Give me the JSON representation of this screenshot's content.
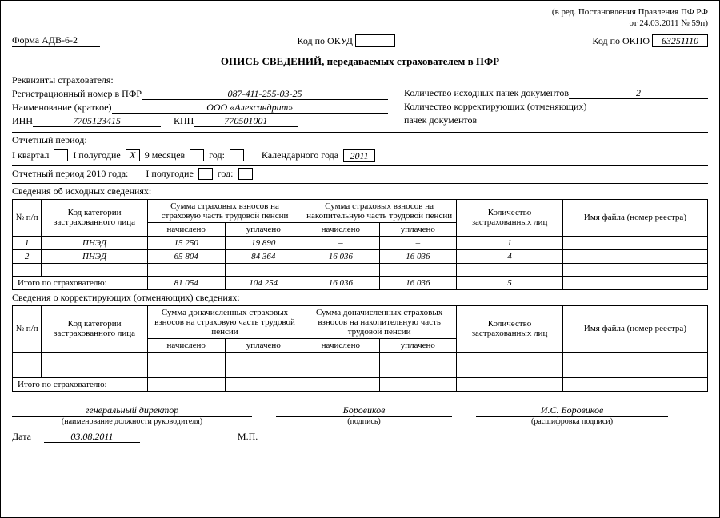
{
  "topnote_line1": "(в ред. Постановления Правления ПФ РФ",
  "topnote_line2": "от 24.03.2011 № 59п)",
  "form_code": "Форма АДВ-6-2",
  "okud_label": "Код по ОКУД",
  "okud_value": "",
  "okpo_label": "Код по ОКПО",
  "okpo_value": "63251110",
  "title": "ОПИСЬ СВЕДЕНИЙ, передаваемых страхователем в ПФР",
  "req_label": "Реквизиты страхователя:",
  "reg_label": "Регистрационный номер в ПФР",
  "reg_value": "087-411-255-03-25",
  "name_label": "Наименование (краткое)",
  "name_value": "ООО «Александрит»",
  "inn_label": "ИНН",
  "inn_value": "7705123415",
  "kpp_label": "КПП",
  "kpp_value": "770501001",
  "count_out_label": "Количество исходных пачек документов",
  "count_out_value": "2",
  "count_corr_label1": "Количество корректирующих (отменяющих)",
  "count_corr_label2": "пачек документов",
  "count_corr_value": "",
  "period_title": "Отчетный период:",
  "q1_label": "I квартал",
  "half_label": "I полугодие",
  "nine_label": "9 месяцев",
  "year_label": "год:",
  "cal_year_label": "Календарного года",
  "cal_year_value": "2011",
  "nine_check": "Х",
  "period2_title": "Отчетный период 2010 года:",
  "source_title": "Сведения об исходных сведениях:",
  "th_num": "№ п/п",
  "th_cat": "Код категории застрахованного лица",
  "th_sum_ins": "Сумма страховых взносов на страховую часть трудовой пенсии",
  "th_sum_acc": "Сумма страховых взносов на накопительную часть трудовой пенсии",
  "th_acc_ins": "Сумма доначисленных страховых взносов на страховую часть трудовой пенсии",
  "th_acc_acc": "Сумма доначисленных страховых взносов на накопительную часть трудовой пенсии",
  "th_count": "Количество застрахованных лиц",
  "th_file": "Имя файла (номер реестра)",
  "th_accrued": "начислено",
  "th_paid": "уплачено",
  "row1": {
    "n": "1",
    "cat": "ПНЭД",
    "ins_a": "15 250",
    "ins_p": "19 890",
    "acc_a": "–",
    "acc_p": "–",
    "cnt": "1"
  },
  "row2": {
    "n": "2",
    "cat": "ПНЭД",
    "ins_a": "65 804",
    "ins_p": "84 364",
    "acc_a": "16 036",
    "acc_p": "16 036",
    "cnt": "4"
  },
  "total_label": "Итого по страхователю:",
  "total": {
    "ins_a": "81 054",
    "ins_p": "104 254",
    "acc_a": "16 036",
    "acc_p": "16 036",
    "cnt": "5"
  },
  "corr_title": "Сведения о корректирующих (отменяющих) сведениях:",
  "sig_position": "генеральный директор",
  "sig_pos_cap": "(наименование должности руководителя)",
  "sig_sign_cap": "(подпись)",
  "sig_name": "И.С. Боровиков",
  "sig_name_cap": "(расшифровка подписи)",
  "sig_sign_script": "Боровиков",
  "date_label": "Дата",
  "date_value": "03.08.2011",
  "mp_label": "М.П."
}
